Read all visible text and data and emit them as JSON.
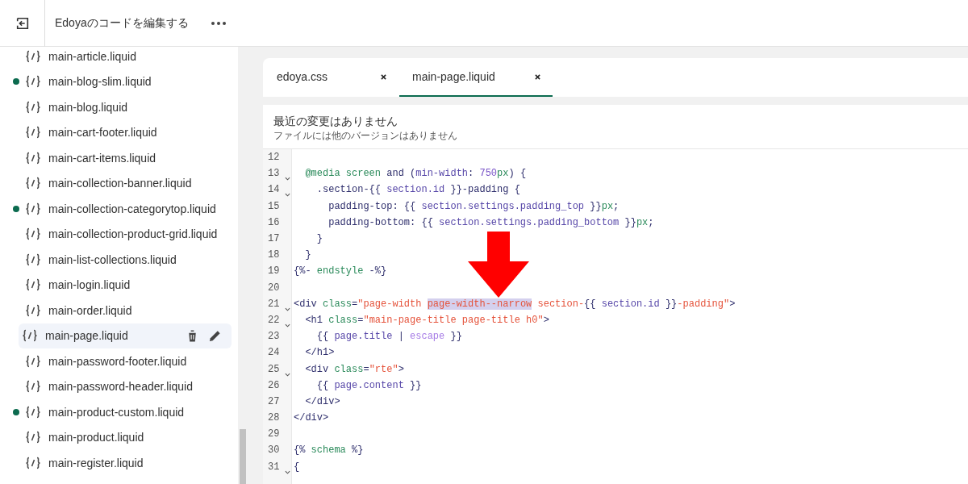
{
  "header": {
    "title": "Edoyaのコードを編集する"
  },
  "files": [
    {
      "name": "main-article.liquid",
      "modified": false,
      "selected": false
    },
    {
      "name": "main-blog-slim.liquid",
      "modified": true,
      "selected": false
    },
    {
      "name": "main-blog.liquid",
      "modified": false,
      "selected": false
    },
    {
      "name": "main-cart-footer.liquid",
      "modified": false,
      "selected": false
    },
    {
      "name": "main-cart-items.liquid",
      "modified": false,
      "selected": false
    },
    {
      "name": "main-collection-banner.liquid",
      "modified": false,
      "selected": false
    },
    {
      "name": "main-collection-categorytop.liquid",
      "modified": true,
      "selected": false
    },
    {
      "name": "main-collection-product-grid.liquid",
      "modified": false,
      "selected": false
    },
    {
      "name": "main-list-collections.liquid",
      "modified": false,
      "selected": false
    },
    {
      "name": "main-login.liquid",
      "modified": false,
      "selected": false
    },
    {
      "name": "main-order.liquid",
      "modified": false,
      "selected": false
    },
    {
      "name": "main-page.liquid",
      "modified": false,
      "selected": true
    },
    {
      "name": "main-password-footer.liquid",
      "modified": false,
      "selected": false
    },
    {
      "name": "main-password-header.liquid",
      "modified": false,
      "selected": false
    },
    {
      "name": "main-product-custom.liquid",
      "modified": true,
      "selected": false
    },
    {
      "name": "main-product.liquid",
      "modified": false,
      "selected": false
    },
    {
      "name": "main-register.liquid",
      "modified": false,
      "selected": false
    }
  ],
  "tabs": [
    {
      "label": "edoya.css",
      "selected": false
    },
    {
      "label": "main-page.liquid",
      "selected": true
    }
  ],
  "notice": {
    "title": "最近の変更はありません",
    "subtitle": "ファイルには他のバージョンはありません"
  },
  "code": [
    {
      "number": "12",
      "foldable": false
    },
    {
      "number": "13",
      "foldable": true,
      "tokens": [
        {
          "kind": "keyword",
          "text": "  @media screen"
        },
        {
          "kind": "plain",
          "text": " and ("
        },
        {
          "kind": "variable",
          "text": "min-width"
        },
        {
          "kind": "plain",
          "text": ": "
        },
        {
          "kind": "number",
          "text": "750"
        },
        {
          "kind": "keyword",
          "text": "px"
        },
        {
          "kind": "plain",
          "text": ") {"
        }
      ]
    },
    {
      "number": "14",
      "foldable": true,
      "tokens": [
        {
          "kind": "plain",
          "text": "    .section-{{ "
        },
        {
          "kind": "variable",
          "text": "section.id"
        },
        {
          "kind": "plain",
          "text": " }}-padding {"
        }
      ]
    },
    {
      "number": "15",
      "foldable": false,
      "tokens": [
        {
          "kind": "plain",
          "text": "      padding-top: {{ "
        },
        {
          "kind": "variable",
          "text": "section.settings.padding_top"
        },
        {
          "kind": "plain",
          "text": " }}"
        },
        {
          "kind": "keyword",
          "text": "px"
        },
        {
          "kind": "plain",
          "text": ";"
        }
      ]
    },
    {
      "number": "16",
      "foldable": false,
      "tokens": [
        {
          "kind": "plain",
          "text": "      padding-bottom: {{ "
        },
        {
          "kind": "variable",
          "text": "section.settings.padding_bottom"
        },
        {
          "kind": "plain",
          "text": " }}"
        },
        {
          "kind": "keyword",
          "text": "px"
        },
        {
          "kind": "plain",
          "text": ";"
        }
      ]
    },
    {
      "number": "17",
      "foldable": false,
      "tokens": [
        {
          "kind": "plain",
          "text": "    }"
        }
      ]
    },
    {
      "number": "18",
      "foldable": false,
      "tokens": [
        {
          "kind": "plain",
          "text": "  }"
        }
      ]
    },
    {
      "number": "19",
      "foldable": false,
      "tokens": [
        {
          "kind": "plain",
          "text": "{%- "
        },
        {
          "kind": "keyword",
          "text": "endstyle"
        },
        {
          "kind": "plain",
          "text": " -%}"
        }
      ]
    },
    {
      "number": "20",
      "foldable": false
    },
    {
      "number": "21",
      "foldable": true,
      "tokens": [
        {
          "kind": "plain",
          "text": "<div "
        },
        {
          "kind": "keyword",
          "text": "class"
        },
        {
          "kind": "plain",
          "text": "="
        },
        {
          "kind": "string",
          "text": "\"page-width "
        },
        {
          "kind": "match",
          "text": "page-width--narrow"
        },
        {
          "kind": "string",
          "text": " section-"
        },
        {
          "kind": "plain",
          "text": "{{ "
        },
        {
          "kind": "variable",
          "text": "section.id"
        },
        {
          "kind": "plain",
          "text": " }}"
        },
        {
          "kind": "string",
          "text": "-padding\""
        },
        {
          "kind": "plain",
          "text": ">"
        }
      ]
    },
    {
      "number": "22",
      "foldable": true,
      "tokens": [
        {
          "kind": "plain",
          "text": "  <h1 "
        },
        {
          "kind": "keyword",
          "text": "class"
        },
        {
          "kind": "plain",
          "text": "="
        },
        {
          "kind": "string",
          "text": "\"main-page-title page-title h0\""
        },
        {
          "kind": "plain",
          "text": ">"
        }
      ]
    },
    {
      "number": "23",
      "foldable": false,
      "tokens": [
        {
          "kind": "plain",
          "text": "    {{ "
        },
        {
          "kind": "variable",
          "text": "page.title"
        },
        {
          "kind": "plain",
          "text": " | "
        },
        {
          "kind": "filter",
          "text": "escape"
        },
        {
          "kind": "plain",
          "text": " }}"
        }
      ]
    },
    {
      "number": "24",
      "foldable": false,
      "tokens": [
        {
          "kind": "plain",
          "text": "  </h1>"
        }
      ]
    },
    {
      "number": "25",
      "foldable": true,
      "tokens": [
        {
          "kind": "plain",
          "text": "  <div "
        },
        {
          "kind": "keyword",
          "text": "class"
        },
        {
          "kind": "plain",
          "text": "="
        },
        {
          "kind": "string",
          "text": "\"rte\""
        },
        {
          "kind": "plain",
          "text": ">"
        }
      ]
    },
    {
      "number": "26",
      "foldable": false,
      "tokens": [
        {
          "kind": "plain",
          "text": "    {{ "
        },
        {
          "kind": "variable",
          "text": "page.content"
        },
        {
          "kind": "plain",
          "text": " }}"
        }
      ]
    },
    {
      "number": "27",
      "foldable": false,
      "tokens": [
        {
          "kind": "plain",
          "text": "  </div>"
        }
      ]
    },
    {
      "number": "28",
      "foldable": false,
      "tokens": [
        {
          "kind": "plain",
          "text": "</div>"
        }
      ]
    },
    {
      "number": "29",
      "foldable": false
    },
    {
      "number": "30",
      "foldable": false,
      "tokens": [
        {
          "kind": "plain",
          "text": "{% "
        },
        {
          "kind": "keyword",
          "text": "schema"
        },
        {
          "kind": "plain",
          "text": " %}"
        }
      ]
    },
    {
      "number": "31",
      "foldable": true,
      "tokens": [
        {
          "kind": "plain",
          "text": "{"
        }
      ]
    }
  ]
}
